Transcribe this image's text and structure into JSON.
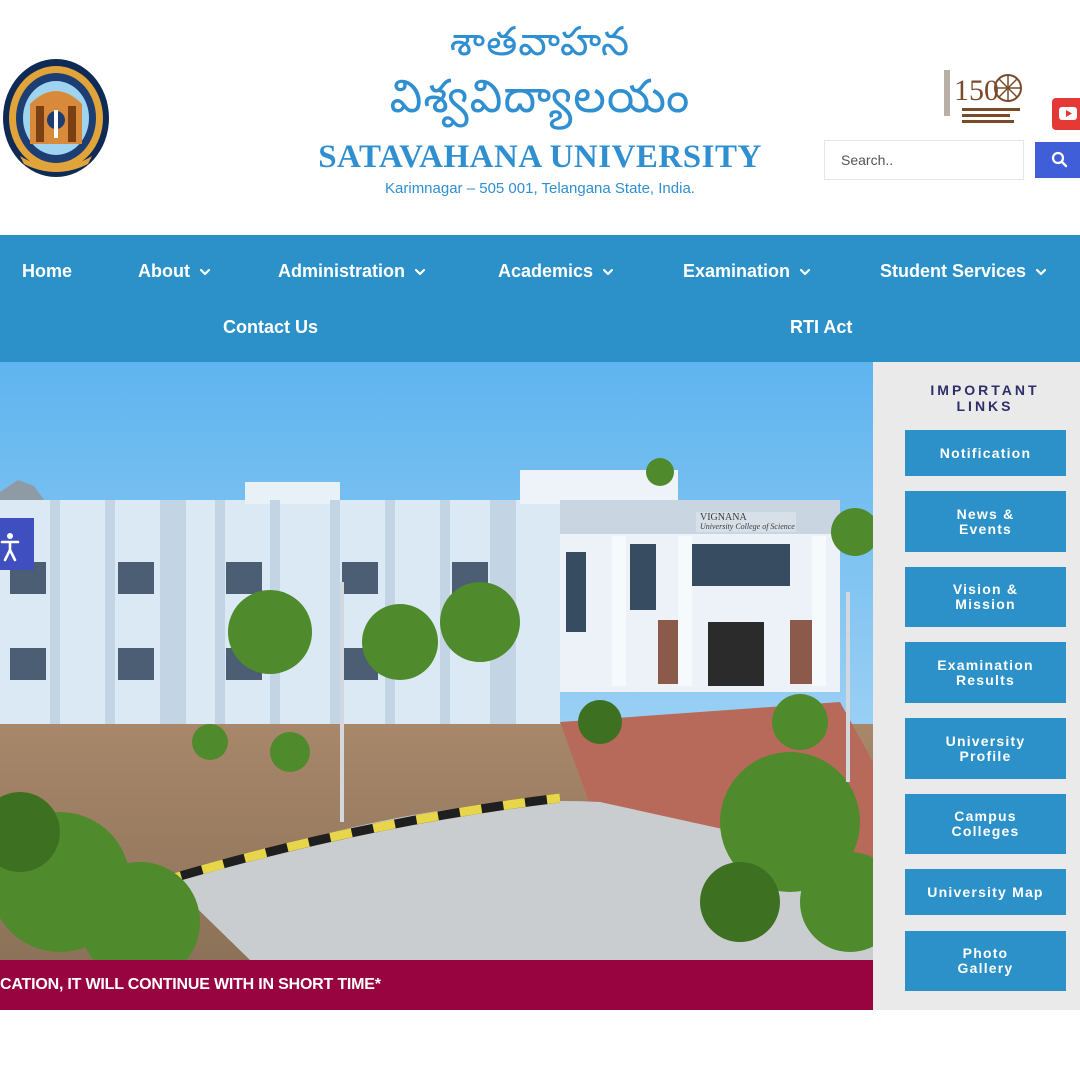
{
  "header": {
    "telugu_line1": "శాతవాహన",
    "telugu_line2": "విశ్వవిద్యాలయం",
    "university_name": "SATAVAHANA UNIVERSITY",
    "address": "Karimnagar – 505 001, Telangana State, India.",
    "logo_icon": "university-seal-icon",
    "anniversary_icon": "150-years-mahatma-icon",
    "youtube_icon": "youtube-icon",
    "search": {
      "placeholder": "Search..",
      "button_icon": "search-icon"
    }
  },
  "nav": {
    "items": [
      {
        "label": "Home",
        "has_dropdown": false
      },
      {
        "label": "About",
        "has_dropdown": true
      },
      {
        "label": "Administration",
        "has_dropdown": true
      },
      {
        "label": "Academics",
        "has_dropdown": true
      },
      {
        "label": "Examination",
        "has_dropdown": true
      },
      {
        "label": "Student Services",
        "has_dropdown": true
      },
      {
        "label": "Contact Us",
        "has_dropdown": false
      },
      {
        "label": "RTI Act",
        "has_dropdown": false
      }
    ]
  },
  "hero": {
    "building_sign": "VIGNANA",
    "building_sign_sub": "University College of Science",
    "ticker_text": "CATION, IT WILL CONTINUE WITH IN SHORT TIME*",
    "accessibility_icon": "accessibility-icon"
  },
  "sidebar": {
    "title_line1": "IMPORTANT",
    "title_line2": "LINKS",
    "links": [
      {
        "line1": "Notification",
        "line2": ""
      },
      {
        "line1": "News &",
        "line2": "Events"
      },
      {
        "line1": "Vision &",
        "line2": "Mission"
      },
      {
        "line1": "Examination",
        "line2": "Results"
      },
      {
        "line1": "University",
        "line2": "Profile"
      },
      {
        "line1": "Campus",
        "line2": "Colleges"
      },
      {
        "line1": "University Map",
        "line2": ""
      },
      {
        "line1": "Photo",
        "line2": "Gallery"
      }
    ]
  },
  "colors": {
    "primary_blue": "#2b91c8",
    "text_blue": "#2f8fd0",
    "ticker_maroon": "#98043f",
    "search_button": "#3f5ed8",
    "sidebar_bg": "#eaeaea",
    "sidebar_title": "#2e2e6a"
  }
}
